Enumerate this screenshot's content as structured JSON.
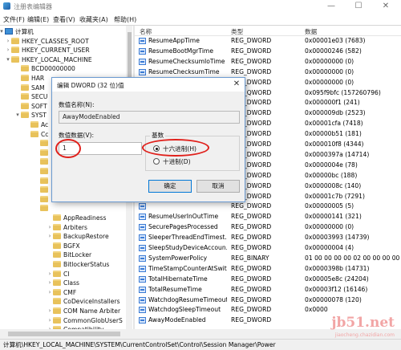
{
  "window": {
    "title": "注册表编辑器",
    "minimize": "—",
    "maximize": "☐",
    "close": "✕"
  },
  "menu": [
    "文件(F)",
    "编辑(E)",
    "查看(V)",
    "收藏夹(A)",
    "帮助(H)"
  ],
  "tree": {
    "items": [
      {
        "label": "计算机",
        "exp": "▾",
        "icon": "computer-icon"
      },
      {
        "label": "HKEY_CLASSES_ROOT",
        "exp": "›",
        "icon": "folder-icon"
      },
      {
        "label": "HKEY_CURRENT_USER",
        "exp": "›",
        "icon": "folder-icon"
      },
      {
        "label": "HKEY_LOCAL_MACHINE",
        "exp": "▾",
        "icon": "folder-icon"
      },
      {
        "label": "BCD00000000",
        "exp": "",
        "icon": "folder-icon"
      },
      {
        "label": "HAR",
        "exp": "",
        "icon": "folder-icon"
      },
      {
        "label": "SAM",
        "exp": "",
        "icon": "folder-icon"
      },
      {
        "label": "SECU",
        "exp": "",
        "icon": "folder-icon"
      },
      {
        "label": "SOFT",
        "exp": "",
        "icon": "folder-icon"
      },
      {
        "label": "SYST",
        "exp": "▾",
        "icon": "folder-icon"
      },
      {
        "label": "Ac",
        "exp": "",
        "icon": "folder-icon"
      },
      {
        "label": "Cc",
        "exp": "",
        "icon": "folder-icon"
      },
      {
        "label": "",
        "exp": "",
        "icon": "folder-icon"
      },
      {
        "label": "",
        "exp": "",
        "icon": "folder-icon"
      },
      {
        "label": "",
        "exp": "",
        "icon": "folder-icon"
      },
      {
        "label": "",
        "exp": "",
        "icon": "folder-icon"
      },
      {
        "label": "",
        "exp": "",
        "icon": "folder-icon"
      },
      {
        "label": "",
        "exp": "",
        "icon": "folder-icon"
      },
      {
        "label": "",
        "exp": "",
        "icon": "folder-icon"
      },
      {
        "label": "",
        "exp": "",
        "icon": "folder-icon"
      },
      {
        "label": "AppReadiness",
        "exp": "",
        "icon": "folder-icon"
      },
      {
        "label": "Arbiters",
        "exp": "›",
        "icon": "folder-icon"
      },
      {
        "label": "BackupRestore",
        "exp": "›",
        "icon": "folder-icon"
      },
      {
        "label": "BGFX",
        "exp": "",
        "icon": "folder-icon"
      },
      {
        "label": "BitLocker",
        "exp": "",
        "icon": "folder-icon"
      },
      {
        "label": "BitlockerStatus",
        "exp": "",
        "icon": "folder-icon"
      },
      {
        "label": "CI",
        "exp": "›",
        "icon": "folder-icon"
      },
      {
        "label": "Class",
        "exp": "›",
        "icon": "folder-icon"
      },
      {
        "label": "CMF",
        "exp": "›",
        "icon": "folder-icon"
      },
      {
        "label": "CoDeviceInstallers",
        "exp": "",
        "icon": "folder-icon"
      },
      {
        "label": "COM Name Arbiter",
        "exp": "›",
        "icon": "folder-icon"
      },
      {
        "label": "CommonGlobUserS",
        "exp": "›",
        "icon": "folder-icon"
      },
      {
        "label": "Compatibility",
        "exp": "›",
        "icon": "folder-icon"
      }
    ]
  },
  "list": {
    "headers": {
      "name": "名称",
      "type": "类型",
      "data": "数据"
    },
    "rows": [
      {
        "name": "ResumeAppTime",
        "type": "REG_DWORD",
        "data": "0x00001e03 (7683)"
      },
      {
        "name": "ResumeBootMgrTime",
        "type": "REG_DWORD",
        "data": "0x00000246 (582)"
      },
      {
        "name": "ResumeChecksumIoTime",
        "type": "REG_DWORD",
        "data": "0x00000000 (0)"
      },
      {
        "name": "ResumeChecksumTime",
        "type": "REG_DWORD",
        "data": "0x00000000 (0)"
      },
      {
        "name": "",
        "type": "REG_DWORD",
        "data": "0x00000000 (0)"
      },
      {
        "name": "",
        "type": "REG_QWORD",
        "data": "0x095f9bfc (157260796)"
      },
      {
        "name": "",
        "type": "REG_DWORD",
        "data": "0x000000f1 (241)"
      },
      {
        "name": "",
        "type": "REG_DWORD",
        "data": "0x000009db (2523)"
      },
      {
        "name": "",
        "type": "REG_DWORD",
        "data": "0x00001cfa (7418)"
      },
      {
        "name": "",
        "type": "REG_DWORD",
        "data": "0x00000b51 (181)"
      },
      {
        "name": "",
        "type": "REG_DWORD",
        "data": "0x000010f8 (4344)"
      },
      {
        "name": "",
        "type": "REG_DWORD",
        "data": "0x0000397a (14714)"
      },
      {
        "name": "",
        "type": "REG_DWORD",
        "data": "0x0000004e (78)"
      },
      {
        "name": "",
        "type": "REG_DWORD",
        "data": "0x00000bc (188)"
      },
      {
        "name": "",
        "type": "REG_DWORD",
        "data": "0x0000008c (140)"
      },
      {
        "name": "",
        "type": "REG_DWORD",
        "data": "0x00001c7b (7291)"
      },
      {
        "name": "",
        "type": "REG_DWORD",
        "data": "0x00000005 (5)"
      },
      {
        "name": "ResumeUserInOutTime",
        "type": "REG_DWORD",
        "data": "0x00000141 (321)"
      },
      {
        "name": "SecurePagesProcessed",
        "type": "REG_DWORD",
        "data": "0x00000000 (0)"
      },
      {
        "name": "SleeperThreadEndTimest...",
        "type": "REG_DWORD",
        "data": "0x00003993 (14739)"
      },
      {
        "name": "SleepStudyDeviceAccoun...",
        "type": "REG_DWORD",
        "data": "0x00000004 (4)"
      },
      {
        "name": "SystemPowerPolicy",
        "type": "REG_BINARY",
        "data": "01 00 00 00 00 02 00 00 00 00 00 00 00 0"
      },
      {
        "name": "TimeStampCounterAtSwit...",
        "type": "REG_DWORD",
        "data": "0x0000398b (14731)"
      },
      {
        "name": "TotalHibernateTime",
        "type": "REG_DWORD",
        "data": "0x00005e8c (24204)"
      },
      {
        "name": "TotalResumeTime",
        "type": "REG_DWORD",
        "data": "0x00003f12 (16146)"
      },
      {
        "name": "WatchdogResumeTimeout",
        "type": "REG_DWORD",
        "data": "0x00000078 (120)"
      },
      {
        "name": "WatchdogSleepTimeout",
        "type": "REG_DWORD",
        "data": "0x0000"
      },
      {
        "name": "AwayModeEnabled",
        "type": "REG_DWORD",
        "data": ""
      }
    ]
  },
  "status": "计算机\\HKEY_LOCAL_MACHINE\\SYSTEM\\CurrentControlSet\\Control\\Session Manager\\Power",
  "dialog": {
    "title": "编辑 DWORD (32 位)值",
    "close": "✕",
    "name_label": "数值名称(N):",
    "name_value": "AwayModeEnabled",
    "data_label": "数值数据(V):",
    "data_value": "1",
    "base_label": "基数",
    "hex_label": "十六进制(H)",
    "dec_label": "十进制(D)",
    "ok_label": "确定",
    "cancel_label": "取消"
  },
  "watermark": {
    "main": "jb51.net",
    "sub": "jiaocheng.chazidian.com"
  },
  "colors": {
    "accent": "#0078d7",
    "annotation": "#e0201b",
    "folder": "#e8c25b"
  }
}
